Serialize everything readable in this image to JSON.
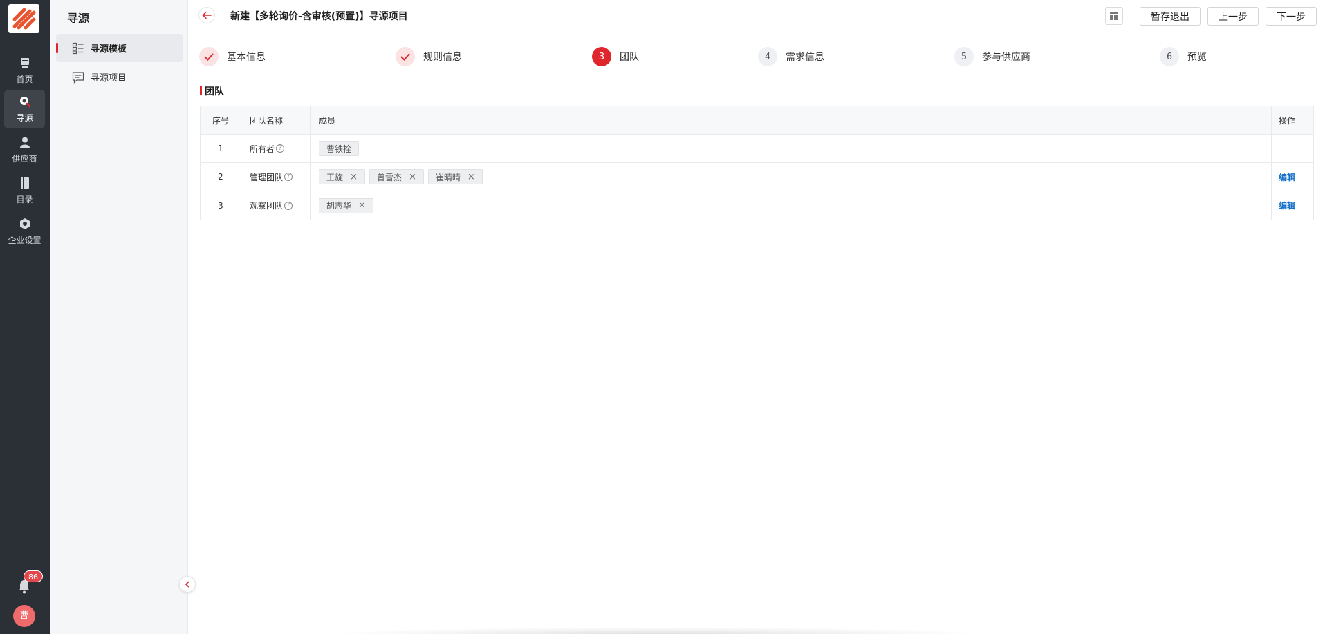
{
  "rail": {
    "items": [
      {
        "label": "首页",
        "icon": "home-icon"
      },
      {
        "label": "寻源",
        "icon": "sourcing-icon"
      },
      {
        "label": "供应商",
        "icon": "supplier-icon"
      },
      {
        "label": "目录",
        "icon": "catalog-icon"
      },
      {
        "label": "企业设置",
        "icon": "settings-icon"
      }
    ],
    "notification_count": "86",
    "avatar_text": "曹"
  },
  "subnav": {
    "title": "寻源",
    "items": [
      {
        "label": "寻源模板",
        "icon": "template-list-icon",
        "active": true
      },
      {
        "label": "寻源项目",
        "icon": "project-chat-icon",
        "active": false
      }
    ]
  },
  "header": {
    "title": "新建【多轮询价-含审核(预置)】寻源项目",
    "buttons": {
      "save_exit": "暂存退出",
      "prev": "上一步",
      "next": "下一步"
    }
  },
  "steps": [
    {
      "number": "1",
      "label": "基本信息",
      "status": "done"
    },
    {
      "number": "2",
      "label": "规则信息",
      "status": "done"
    },
    {
      "number": "3",
      "label": "团队",
      "status": "current"
    },
    {
      "number": "4",
      "label": "需求信息",
      "status": "todo"
    },
    {
      "number": "5",
      "label": "参与供应商",
      "status": "todo"
    },
    {
      "number": "6",
      "label": "预览",
      "status": "todo"
    }
  ],
  "section": {
    "title": "团队"
  },
  "table": {
    "headers": {
      "no": "序号",
      "name": "团队名称",
      "members": "成员",
      "op": "操作"
    },
    "rows": [
      {
        "no": "1",
        "name": "所有者",
        "members": [
          {
            "name": "曹铁拴",
            "removable": false
          }
        ],
        "op": ""
      },
      {
        "no": "2",
        "name": "管理团队",
        "members": [
          {
            "name": "王旋",
            "removable": true
          },
          {
            "name": "曾雪杰",
            "removable": true
          },
          {
            "name": "崔晴晴",
            "removable": true
          }
        ],
        "op": "编辑"
      },
      {
        "no": "3",
        "name": "观察团队",
        "members": [
          {
            "name": "胡志华",
            "removable": true
          }
        ],
        "op": "编辑"
      }
    ],
    "remove_glyph": "×",
    "help_glyph": "?"
  },
  "colors": {
    "accent": "#e0262d",
    "link": "#1570c8",
    "rail_bg": "#2b2f36"
  }
}
